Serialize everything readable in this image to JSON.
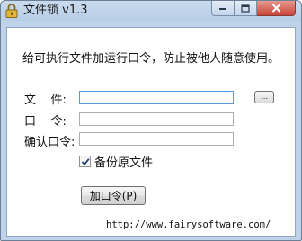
{
  "window": {
    "title": "文件锁 v1.3",
    "icon": "padlock-icon",
    "caption_buttons": [
      "minimize-icon",
      "maximize-icon",
      "close-icon"
    ]
  },
  "dialog": {
    "hint": "给可执行文件加运行口令，防止被他人随意使用。",
    "file_label": "文    件:",
    "file_value": "",
    "browse_label": "...",
    "password_label": "口    令:",
    "password_value": "",
    "confirm_label": "确认口令:",
    "confirm_value": "",
    "backup_checkbox": {
      "label": "备份原文件",
      "checked": true
    },
    "add_button_label": "加口令(P)",
    "website": "http://www.fairysoftware.com/"
  },
  "colors": {
    "titlebar": "#bfd4ea",
    "close_button": "#c8443a",
    "input_focus_border": "#5a9bd6"
  }
}
